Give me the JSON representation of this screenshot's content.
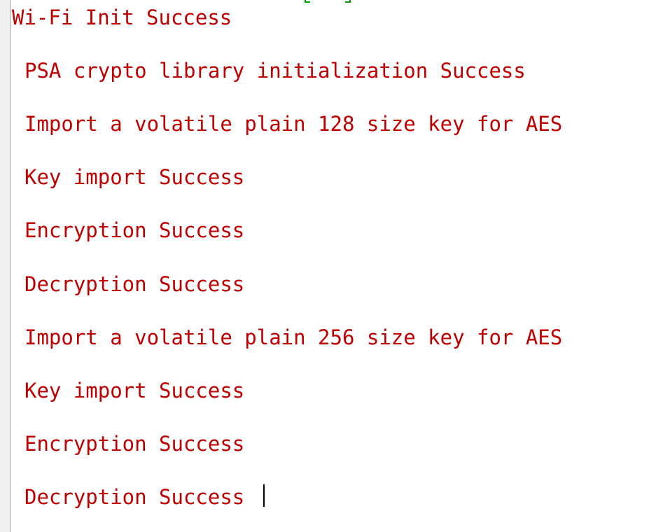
{
  "terminal": {
    "lines": [
      "Wi-Fi Init Success",
      "PSA crypto library initialization Success",
      "Import a volatile plain 128 size key for AES",
      "Key import Success",
      "Encryption Success",
      "Decryption Success",
      "Import a volatile plain 256 size key for AES",
      "Key import Success",
      "Encryption Success",
      "Decryption Success"
    ],
    "text_color": "#c00000"
  }
}
